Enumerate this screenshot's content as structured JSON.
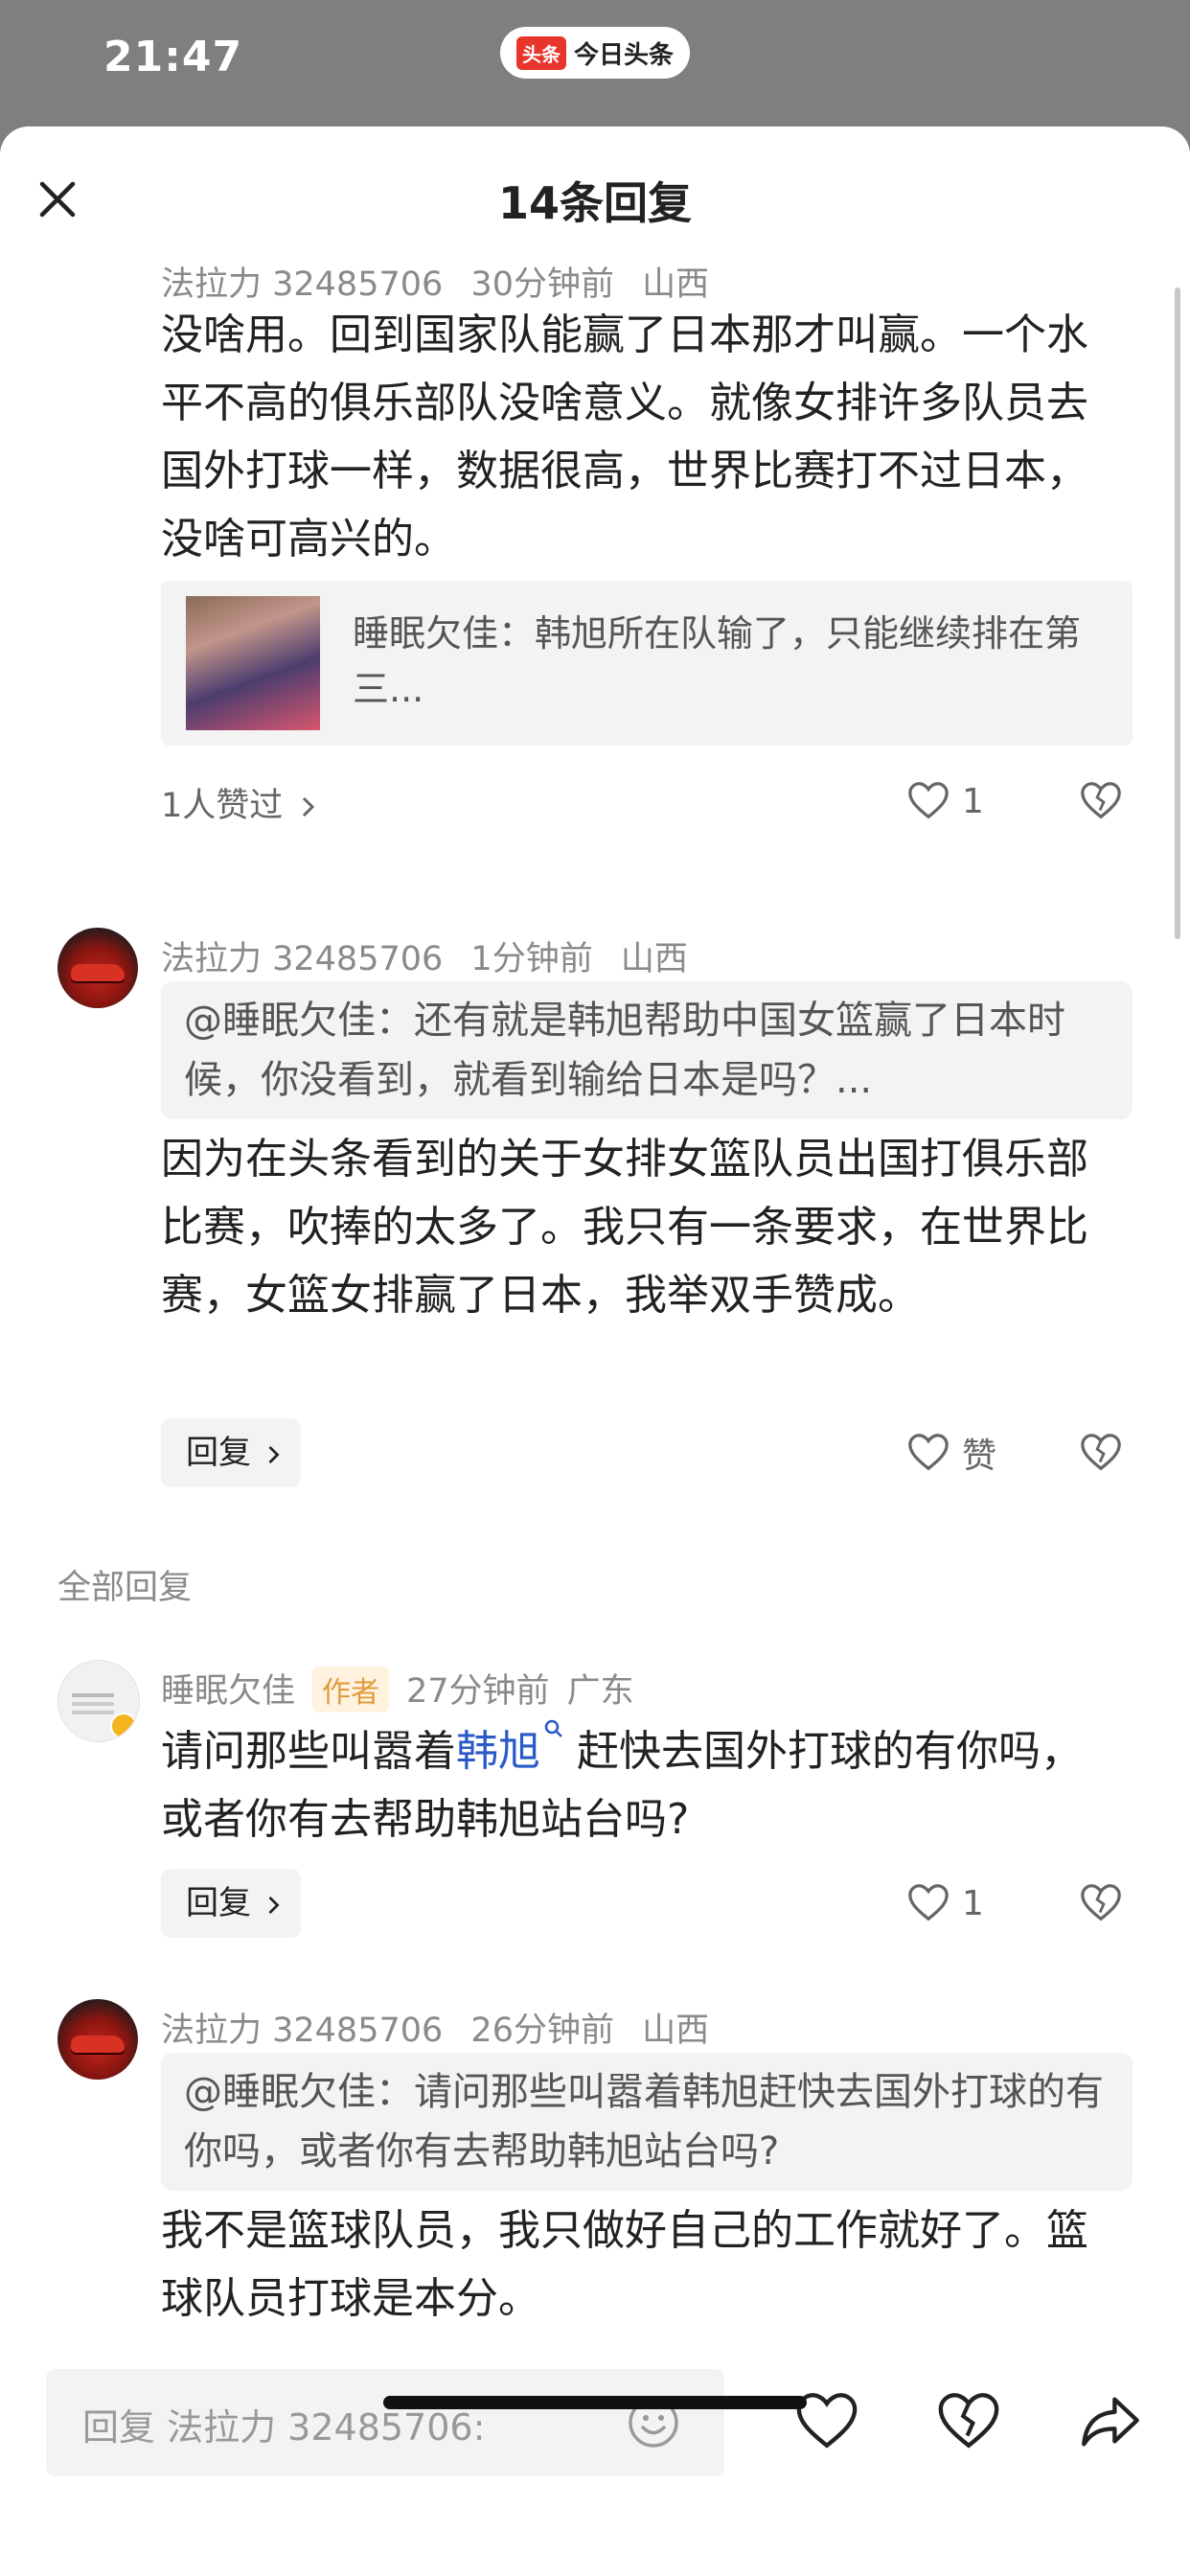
{
  "status_bar": {
    "time": "21:47",
    "app_logo": "头条",
    "app_name": "今日头条"
  },
  "header": {
    "title": "14条回复"
  },
  "comments": [
    {
      "user": "法拉力 32485706",
      "time": "30分钟前",
      "location": "山西",
      "text": "没啥用。回到国家队能赢了日本那才叫赢。一个水平不高的俱乐部队没啥意义。就像女排许多队员去国外打球一样，数据很高，世界比赛打不过日本，没啥可高兴的。",
      "link_card": "睡眠欠佳：韩旭所在队输了，只能继续排在第三...",
      "likers": "1人赞过",
      "like_count": "1"
    },
    {
      "user": "法拉力 32485706",
      "time": "1分钟前",
      "location": "山西",
      "quote": "@睡眠欠佳：还有就是韩旭帮助中国女篮赢了日本时候，你没看到，就看到输给日本是吗？...",
      "text": "因为在头条看到的关于女排女篮队员出国打俱乐部比赛，吹捧的太多了。我只有一条要求，在世界比赛，女篮女排赢了日本，我举双手赞成。",
      "reply_label": "回复",
      "like_label": "赞"
    }
  ],
  "section_label": "全部回复",
  "replies": [
    {
      "user": "睡眠欠佳",
      "author_tag": "作者",
      "time": "27分钟前",
      "location": "广东",
      "text_before": "请问那些叫嚣着",
      "topic": "韩旭",
      "text_after": "赶快去国外打球的有你吗，或者你有去帮助韩旭站台吗?",
      "reply_label": "回复",
      "like_count": "1"
    },
    {
      "user": "法拉力 32485706",
      "time": "26分钟前",
      "location": "山西",
      "quote": "@睡眠欠佳：请问那些叫嚣着韩旭赶快去国外打球的有你吗，或者你有去帮助韩旭站台吗?",
      "text": "我不是篮球队员，我只做好自己的工作就好了。篮球队员打球是本分。"
    }
  ],
  "bottom_bar": {
    "placeholder": "回复 法拉力 32485706:"
  },
  "colors": {
    "link": "#2a5ac8",
    "author_tag_text": "#e19a3a",
    "author_tag_bg": "#fff3e0",
    "brand_red": "#e8352b"
  },
  "icons": [
    "close-icon",
    "heart-icon",
    "heart-broken-icon",
    "chevron-right-icon",
    "search-icon",
    "emoji-icon",
    "share-icon"
  ]
}
